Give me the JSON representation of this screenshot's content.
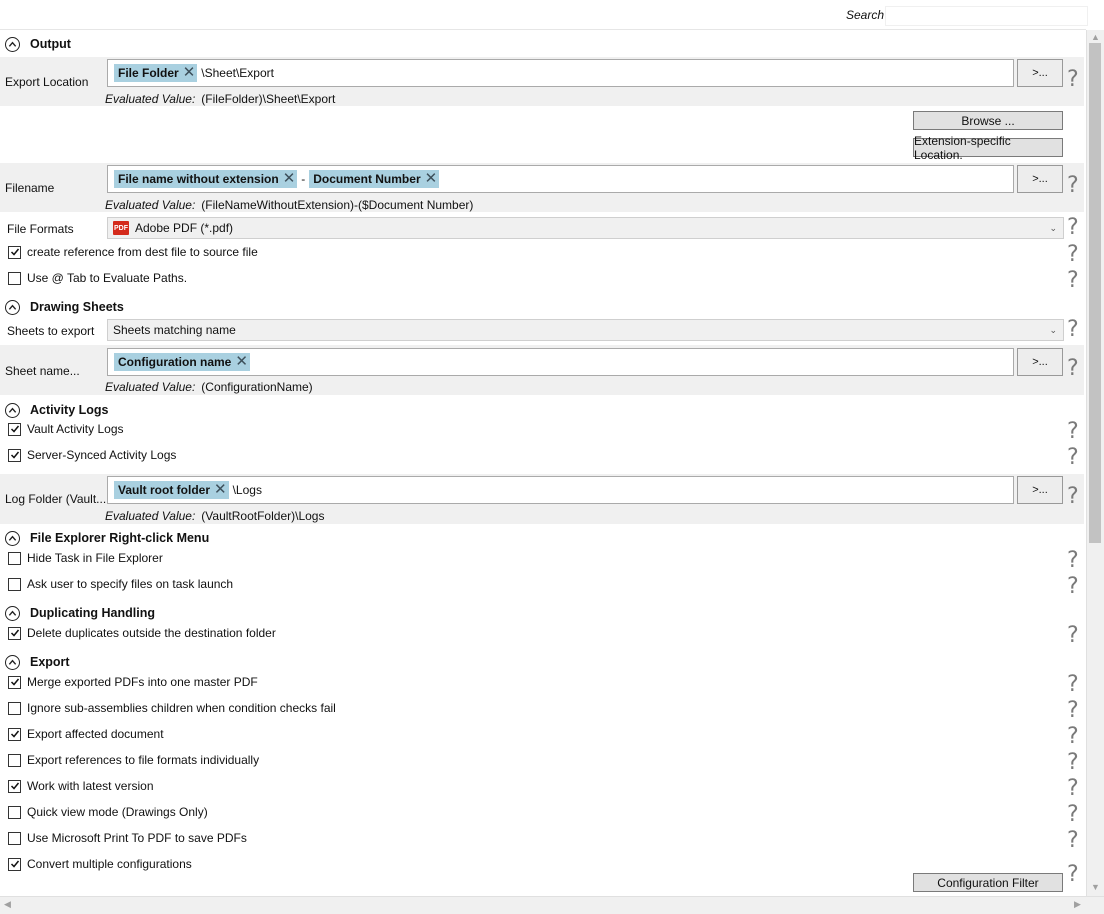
{
  "search": {
    "label": "Search",
    "placeholder": ""
  },
  "output": {
    "title": "Output",
    "export_location": {
      "label": "Export Location",
      "token": "File Folder",
      "suffix": "\\Sheet\\Export",
      "eval_label": "Evaluated Value:",
      "eval_value": "(FileFolder)\\Sheet\\Export",
      "button": ">..."
    },
    "browse_button": "Browse ...",
    "ext_button": "Extension-specific Location.",
    "filename": {
      "label": "Filename",
      "token1": "File name without extension",
      "separator": "-",
      "token2": "Document Number",
      "eval_label": "Evaluated Value:",
      "eval_value": "(FileNameWithoutExtension)-($Document Number)",
      "button": ">..."
    },
    "file_formats": {
      "label": "File Formats",
      "value": "Adobe PDF (*.pdf)",
      "icon": "pdf-icon"
    },
    "create_reference": {
      "label": "create reference from dest file to source file",
      "checked": true
    },
    "use_at_tab": {
      "label": "Use @ Tab to Evaluate Paths.",
      "checked": false
    }
  },
  "drawing_sheets": {
    "title": "Drawing Sheets",
    "sheets_to_export": {
      "label": "Sheets to export",
      "value": "Sheets matching name"
    },
    "sheet_name": {
      "label": "Sheet name...",
      "token": "Configuration name",
      "eval_label": "Evaluated Value:",
      "eval_value": "(ConfigurationName)",
      "button": ">..."
    }
  },
  "activity_logs": {
    "title": "Activity Logs",
    "vault_logs": {
      "label": "Vault Activity Logs",
      "checked": true
    },
    "server_logs": {
      "label": "Server-Synced Activity Logs",
      "checked": true
    },
    "log_folder": {
      "label": "Log Folder (Vault...",
      "token": "Vault root folder",
      "suffix": "\\Logs",
      "eval_label": "Evaluated Value:",
      "eval_value": "(VaultRootFolder)\\Logs",
      "button": ">..."
    }
  },
  "explorer_menu": {
    "title": "File Explorer Right-click Menu",
    "hide_task": {
      "label": "Hide Task in File Explorer",
      "checked": false
    },
    "ask_user": {
      "label": "Ask user to specify files on task launch",
      "checked": false
    }
  },
  "duplicating": {
    "title": "Duplicating Handling",
    "delete_dupes": {
      "label": "Delete duplicates outside the destination folder",
      "checked": true
    }
  },
  "export": {
    "title": "Export",
    "merge": {
      "label": "Merge exported PDFs into one master PDF",
      "checked": true
    },
    "ignore_sub": {
      "label": "Ignore sub-assemblies children when condition checks fail",
      "checked": false
    },
    "export_affected": {
      "label": "Export affected document",
      "checked": true
    },
    "export_refs": {
      "label": "Export references to file formats individually",
      "checked": false
    },
    "latest_version": {
      "label": "Work with latest version",
      "checked": true
    },
    "quick_view": {
      "label": "Quick view mode (Drawings Only)",
      "checked": false
    },
    "ms_print": {
      "label": "Use Microsoft Print To PDF to save PDFs",
      "checked": false
    },
    "convert_configs": {
      "label": "Convert multiple configurations",
      "checked": true
    },
    "config_filter_button": "Configuration Filter"
  },
  "help_glyph": "?"
}
